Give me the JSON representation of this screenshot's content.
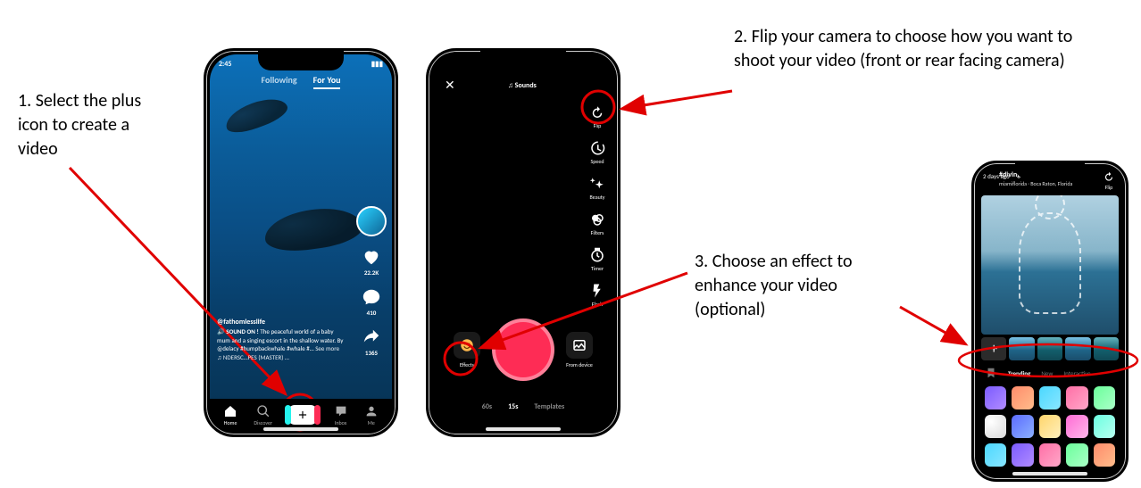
{
  "callouts": {
    "step1": "1. Select the plus icon to create a video",
    "step2": "2. Flip your camera to choose how you want to shoot your video (front or rear facing camera)",
    "step3": "3. Choose an effect to enhance your video (optional)"
  },
  "phone1": {
    "status_time": "2:45",
    "tabs": {
      "following": "Following",
      "forYou": "For You"
    },
    "rail": {
      "likes": "22.2K",
      "comments": "410",
      "shares": "1365"
    },
    "caption": {
      "user": "@fathomlesslife",
      "prefix": "🔊 SOUND ON !",
      "body": "The peaceful world of a baby mum and a singing escort in the shallow water. By @delacy #humpbackwhale #whale #…",
      "more": "See more",
      "sound": "♫ NDERSC…PES (MASTER) …"
    },
    "nav": {
      "home": "Home",
      "discover": "Discover",
      "inbox": "Inbox",
      "me": "Me"
    }
  },
  "phone2": {
    "top": {
      "close": "✕",
      "sounds": "♫ Sounds"
    },
    "tools": {
      "flip": "Flip",
      "speed": "Speed",
      "beauty": "Beauty",
      "filters": "Filters",
      "timer": "Timer",
      "flash": "Flash"
    },
    "bottom": {
      "effects": "Effects",
      "fromDevice": "From device"
    },
    "modes": {
      "sixty": "60s",
      "fifteen": "15s",
      "templates": "Templates"
    }
  },
  "phone3": {
    "back_label": "2 days ago",
    "title": "#diving",
    "location": "miamiflorida · Boca Raton, Florida",
    "flip": "Flip",
    "tabs": {
      "trending": "Trending",
      "new": "New",
      "interactive": "Interactive"
    }
  }
}
